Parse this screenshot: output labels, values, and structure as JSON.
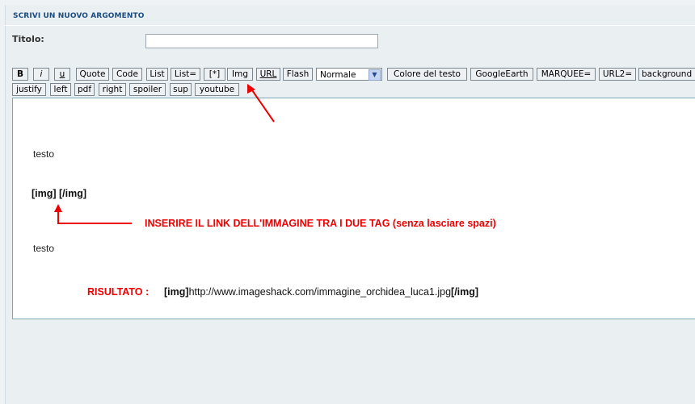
{
  "header": {
    "title": "SCRIVI UN NUOVO ARGOMENTO"
  },
  "form": {
    "title_label": "Titolo:",
    "title_value": "",
    "title_placeholder": ""
  },
  "toolbar": {
    "row1": [
      "B",
      "i",
      "u",
      "Quote",
      "Code",
      "List",
      "List=",
      "[*]",
      "Img",
      "URL",
      "Flash"
    ],
    "font_size_select": "Normale",
    "row1_after": [
      "Colore del testo",
      "GoogleEarth",
      "MARQUEE=",
      "URL2=",
      "background"
    ],
    "row2": [
      "justify",
      "left",
      "pdf",
      "right",
      "spoiler",
      "sup",
      "youtube"
    ]
  },
  "editor": {
    "line1": "testo",
    "img_tags": "[img] [/img]",
    "note": "INSERIRE IL LINK DELL'IMMAGINE TRA I DUE TAG  (senza lasciare spazi)",
    "line2": "testo",
    "result_label": "RISULTATO :",
    "result_open_tag": "[img]",
    "result_url": "http://www.imageshack.com/immagine_orchidea_luca1.jpg",
    "result_close_tag": "[/img]"
  },
  "colors": {
    "accent": "#1c4d80",
    "annotation": "#ee0000",
    "editor_border": "#78a8b8"
  },
  "icons": {
    "select_arrow": "chevron-down-icon"
  }
}
